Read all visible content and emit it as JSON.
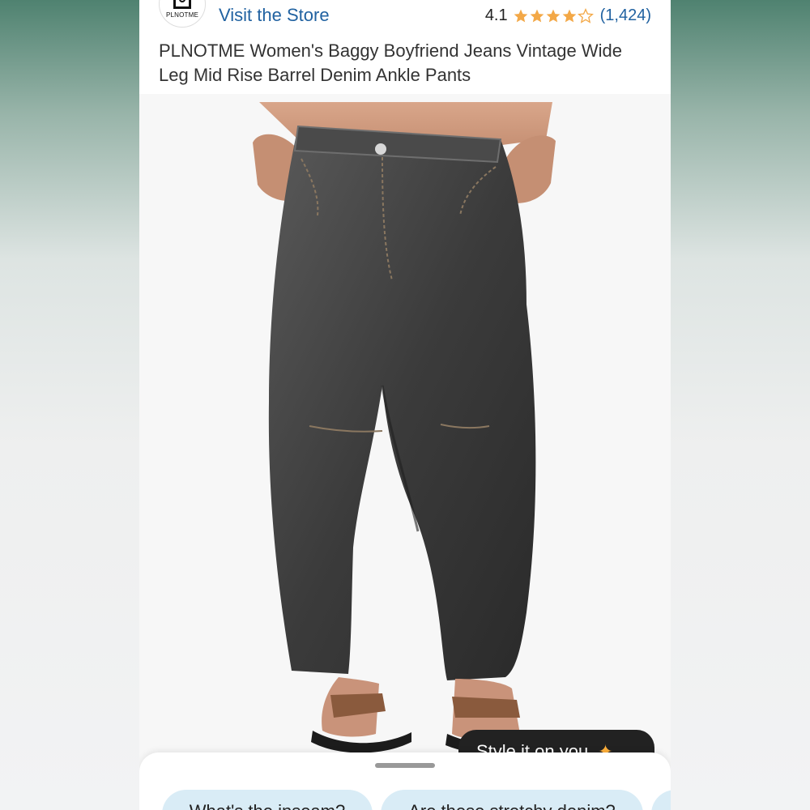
{
  "brand": {
    "logo_text": "PLNOTME",
    "visit_store_label": "Visit the Store"
  },
  "rating": {
    "value": "4.1",
    "stars": 4.1,
    "max_stars": 5,
    "count": "(1,424)",
    "star_color": "#f3a847",
    "link_color": "#2162a1"
  },
  "product": {
    "title": "PLNOTME Women's Baggy Boyfriend Jeans Vintage Wide Leg Mid Rise Barrel Denim Ankle Pants"
  },
  "style_button": {
    "label": "Style it on you",
    "icon": "sparkle-icon"
  },
  "questions": {
    "chips": [
      "What's the inseam?",
      "Are these stretchy denim?"
    ]
  }
}
